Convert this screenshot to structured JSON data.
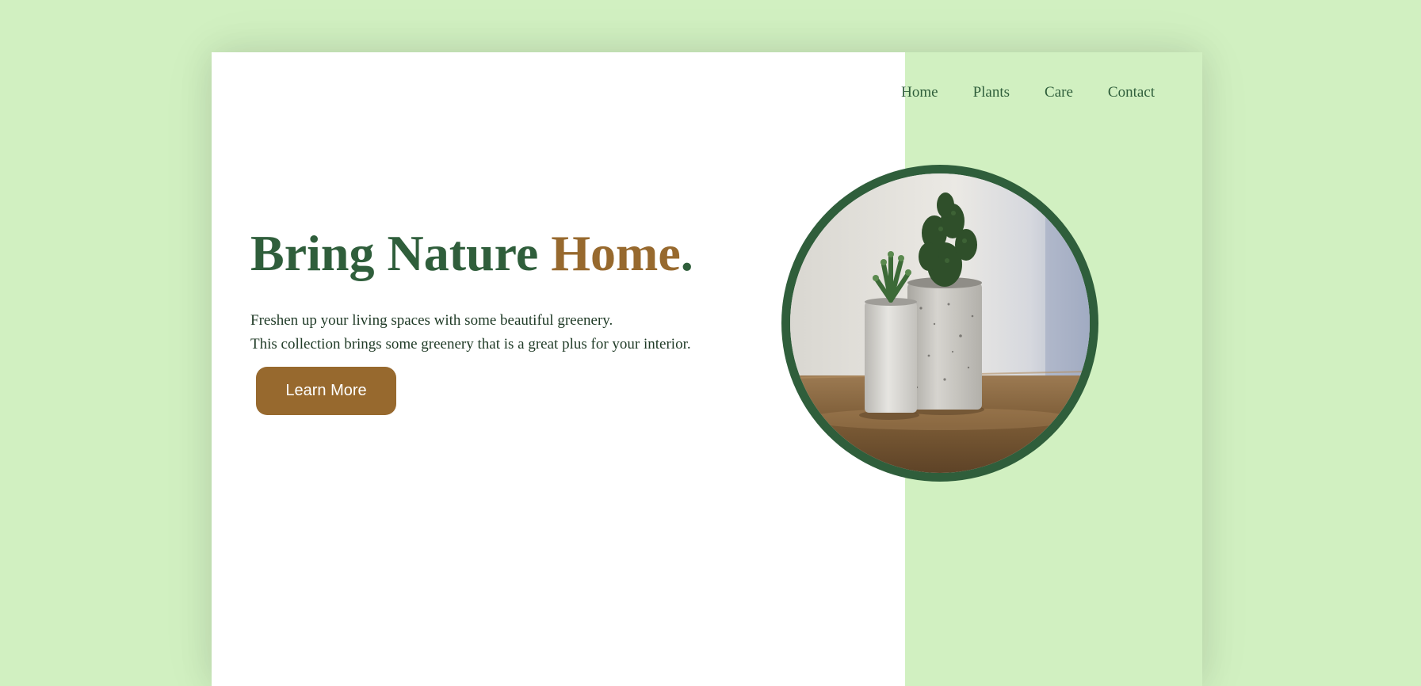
{
  "nav": {
    "items": [
      "Home",
      "Plants",
      "Care",
      "Contact"
    ]
  },
  "hero": {
    "title_part1": "Bring Nature ",
    "title_part2": "Home",
    "title_part3": ".",
    "description_line1": "Freshen up your living spaces with some beautiful greenery.",
    "description_line2": "This collection brings some greenery that is a great plus for your interior.",
    "cta_label": "Learn More"
  },
  "colors": {
    "page_background": "#d1f0c1",
    "primary_green": "#2f5e3b",
    "accent_brown": "#97692e",
    "text_dark": "#1f3a26"
  },
  "image": {
    "subject": "two potted plants in concrete cylinders"
  }
}
